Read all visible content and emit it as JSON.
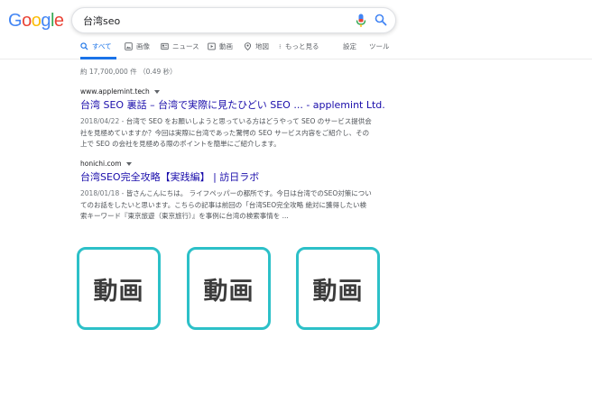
{
  "logo": {
    "letters": [
      "G",
      "o",
      "o",
      "g",
      "l",
      "e"
    ],
    "colors": [
      "#4285f4",
      "#ea4335",
      "#fbbc05",
      "#4285f4",
      "#34a853",
      "#ea4335"
    ]
  },
  "search": {
    "query": "台湾seo",
    "mic_icon": "mic-icon",
    "search_icon": "search-icon"
  },
  "tabs": [
    {
      "label": "すべて",
      "icon": "search-icon",
      "active": true
    },
    {
      "label": "画像",
      "icon": "image-icon",
      "active": false
    },
    {
      "label": "ニュース",
      "icon": "news-icon",
      "active": false
    },
    {
      "label": "動画",
      "icon": "video-icon",
      "active": false
    },
    {
      "label": "地図",
      "icon": "map-pin-icon",
      "active": false
    },
    {
      "label": "もっと見る",
      "icon": "more-vert-icon",
      "active": false
    },
    {
      "label": "設定",
      "active": false
    },
    {
      "label": "ツール",
      "active": false
    }
  ],
  "stats": "約 17,700,000 件 （0.49 秒）",
  "results": [
    {
      "cite": "www.applemint.tech",
      "title": "台湾 SEO 裏話 – 台湾で実際に見たひどい SEO ... - applemint Ltd.",
      "date": "2018/04/22 - ",
      "snippet_lines": [
        "台湾で SEO をお願いしようと思っている方はどうやって SEO のサービス提供会",
        "社を見極めていますか？今回は実際に台湾であった驚愕の SEO サービス内容をご紹介し、その",
        "上で SEO の会社を見極める際のポイントを簡単にご紹介します。"
      ]
    },
    {
      "cite": "honichi.com",
      "title": "台湾SEO完全攻略【実践編】 | 訪日ラボ",
      "date": "2018/01/18 - ",
      "snippet_lines": [
        "皆さんこんにちは。 ライフペッパーの都所です。今日は台湾でのSEO対策につい",
        "てのお話をしたいと思います。こちらの記事は前回の「台湾SEO完全攻略 絶対に獲得したい検",
        "索キーワード『東京旅遊（東京旅行）』を事例に台湾の検索事情を ..."
      ]
    }
  ],
  "video_cards": [
    "動画",
    "動画",
    "動画"
  ],
  "colors": {
    "link": "#1a0dab",
    "accent": "#1a73e8",
    "card_border": "#2cc0c8"
  }
}
